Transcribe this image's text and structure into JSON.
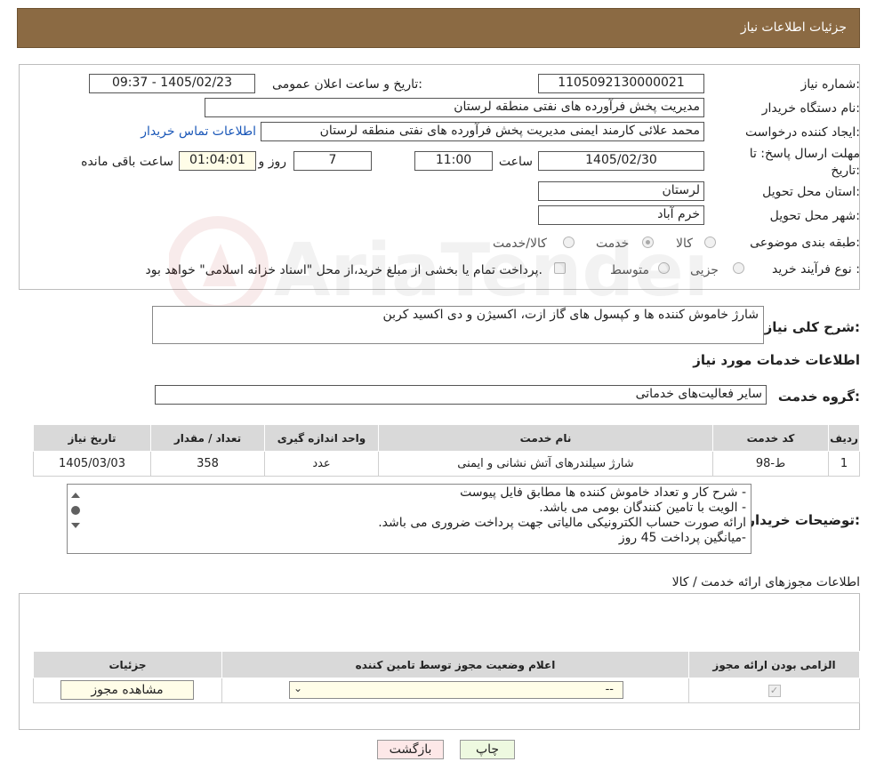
{
  "header": {
    "title": "جزئیات اطلاعات نیاز"
  },
  "need": {
    "number_label": "شماره نیاز:",
    "number_value": "1105092130000021",
    "announce_label": "تاریخ و ساعت اعلان عمومی:",
    "announce_value": "1405/02/23 - 09:37",
    "buyer_label": "نام دستگاه خریدار:",
    "buyer_value": "مدیریت پخش فرآورده های نفتی منطقه لرستان",
    "requester_label": "ایجاد کننده درخواست:",
    "requester_value": "محمد علائی کارمند ایمنی مدیریت پخش فرآورده های نفتی منطقه لرستان",
    "contact_link": "اطلاعات تماس خریدار",
    "deadline_label_1": "مهلت ارسال پاسخ: تا",
    "deadline_label_2": "تاریخ:",
    "deadline_date": "1405/02/30",
    "time_label": "ساعت",
    "time_value": "11:00",
    "days_value": "7",
    "days_label": "روز و",
    "remaining_value": "01:04:01",
    "remaining_label": "ساعت باقی مانده",
    "province_label": "استان محل تحویل:",
    "province_value": "لرستان",
    "city_label": "شهر محل تحویل:",
    "city_value": "خرم آباد",
    "category_label": "طبقه بندی موضوعی:",
    "category_options": [
      "کالا",
      "خدمت",
      "کالا/خدمت"
    ],
    "category_selected": "خدمت",
    "process_label": "نوع فرآیند خرید :",
    "process_options": [
      "جزیی",
      "متوسط"
    ],
    "process_note": "پرداخت تمام یا بخشی از مبلغ خرید،از محل \"اسناد خزانه اسلامی\" خواهد بود."
  },
  "summary": {
    "label": "شرح کلی نیاز:",
    "value": "شارژ خاموش کننده ها و کپسول های گاز ازت، اکسیژن و دی اکسید کربن"
  },
  "services": {
    "section_title": "اطلاعات خدمات مورد نیاز",
    "group_label": "گروه خدمت:",
    "group_value": "سایر فعالیت‌های خدماتی",
    "columns": [
      "ردیف",
      "کد خدمت",
      "نام خدمت",
      "واحد اندازه گیری",
      "تعداد / مقدار",
      "تاریخ نیاز"
    ],
    "rows": [
      [
        "1",
        "ط-98",
        "شارژ سیلندرهای آتش نشانی و ایمنی",
        "عدد",
        "358",
        "1405/03/03"
      ]
    ]
  },
  "buyer_notes": {
    "label": "توضیحات خریدار:",
    "lines": [
      "- شرح کار و تعداد خاموش کننده ها مطابق فایل پیوست",
      "- الویت با تامین کنندگان بومی می باشد.",
      "ارائه صورت حساب الکترونیکی مالیاتی جهت پرداخت ضروری می باشد.",
      "-میانگین پرداخت 45 روز"
    ]
  },
  "permits": {
    "section_title": "اطلاعات مجوزهای ارائه خدمت / کالا",
    "columns": [
      "الزامی بودن ارائه مجوز",
      "اعلام وضعیت مجوز توسط تامین کننده",
      "جزئیات"
    ],
    "select_value": "--",
    "view_button": "مشاهده مجوز"
  },
  "actions": {
    "print": "چاپ",
    "back": "بازگشت"
  },
  "watermark": {
    "text": "AriaTender.neT"
  }
}
